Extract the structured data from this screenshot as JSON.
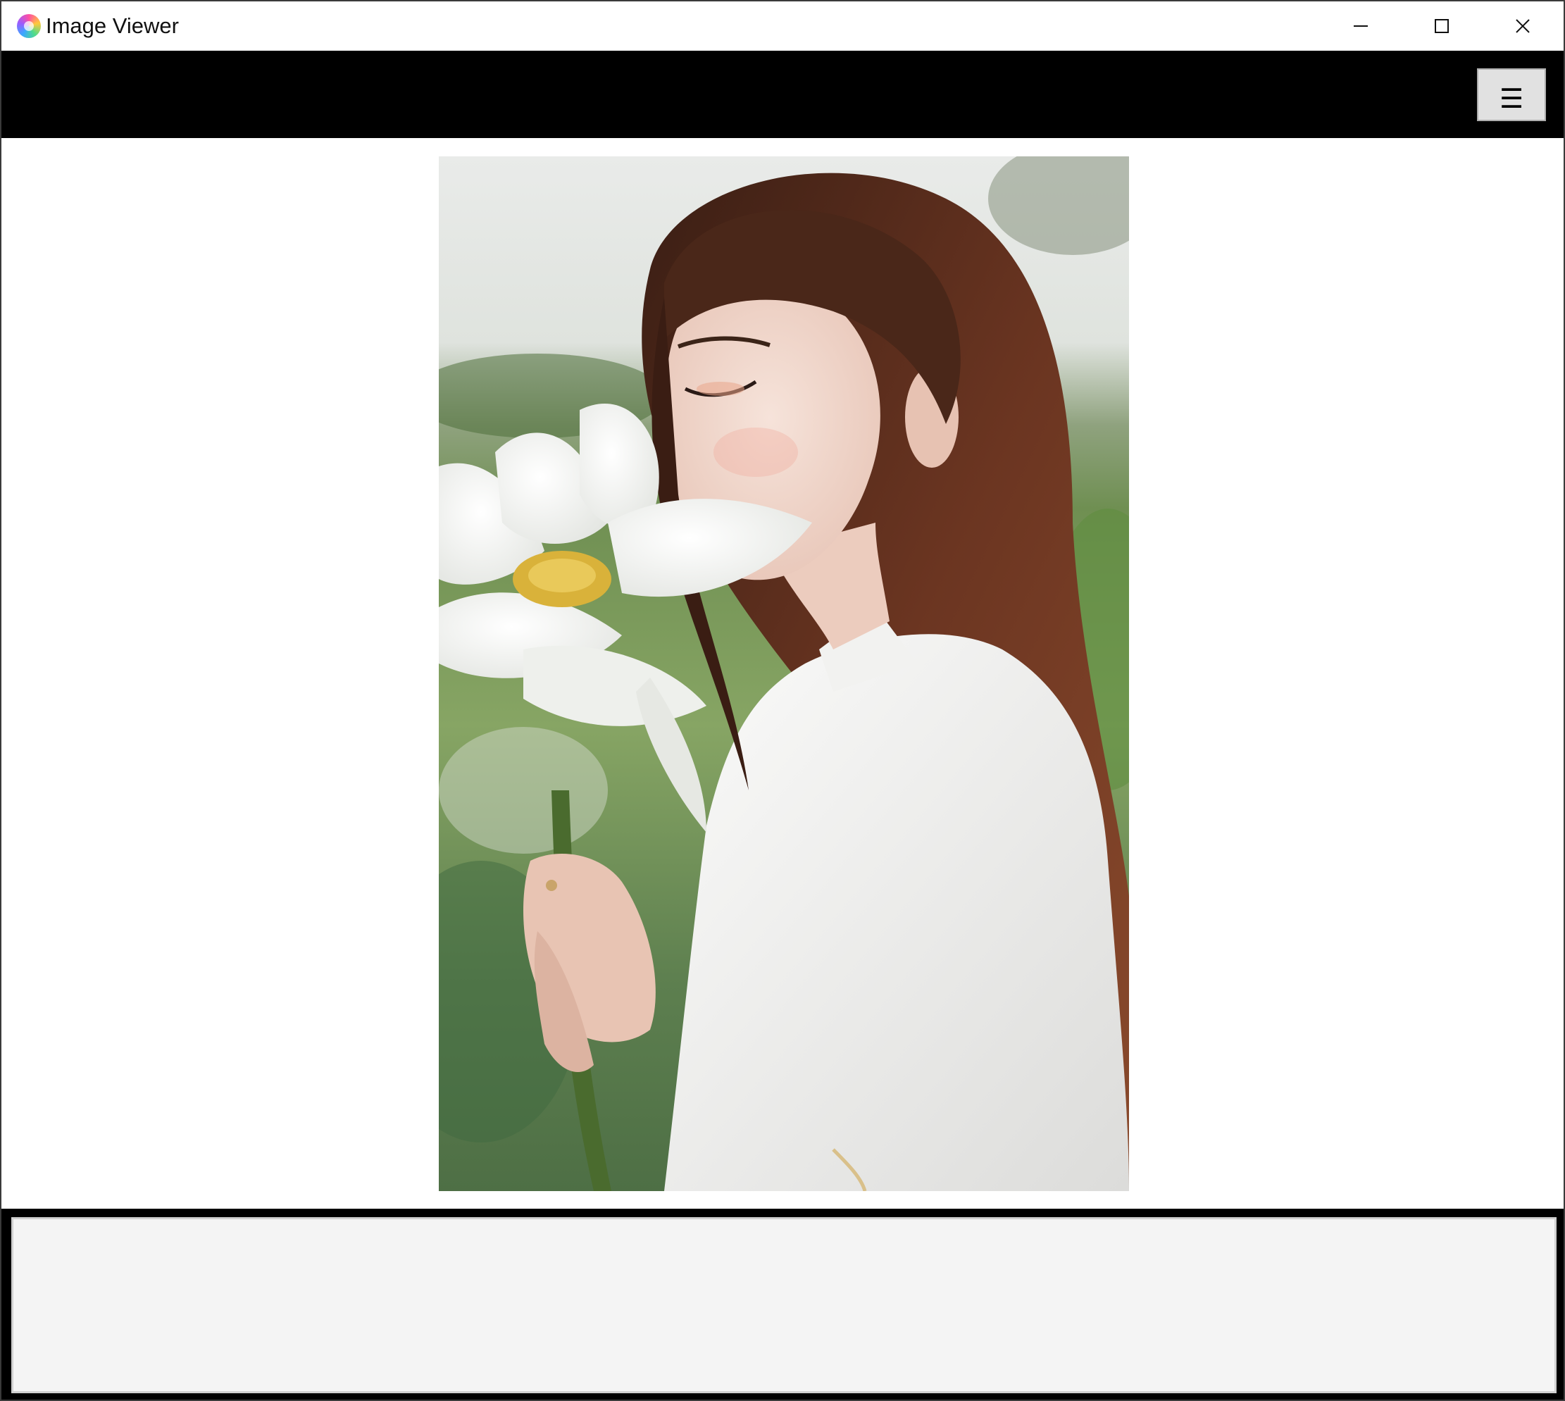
{
  "window": {
    "title": "Image Viewer",
    "icon": "app-icon"
  },
  "title_buttons": {
    "minimize_icon": "minimize-icon",
    "maximize_icon": "maximize-icon",
    "close_icon": "close-icon"
  },
  "toolbar": {
    "menu_label": "☰",
    "menu_icon": "hamburger-menu-icon"
  },
  "viewer": {
    "image_description_icon": "photo"
  },
  "thumbnail_strip": {
    "items": []
  },
  "colors": {
    "toolbar_bg": "#000000",
    "menu_button_bg": "#e1e1e1",
    "viewer_bg": "#ffffff",
    "thumb_strip_bg": "#f4f4f4"
  }
}
